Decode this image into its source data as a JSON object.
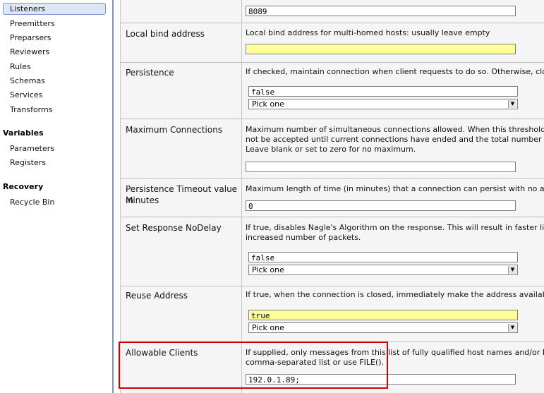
{
  "sidebar": {
    "items": [
      "Listeners",
      "Preemitters",
      "Preparsers",
      "Reviewers",
      "Rules",
      "Schemas",
      "Services",
      "Transforms"
    ],
    "variables_heading": "Variables",
    "variables": [
      "Parameters",
      "Registers"
    ],
    "recovery_heading": "Recovery",
    "recovery": [
      "Recycle Bin"
    ]
  },
  "rows": {
    "port": {
      "value": "8089"
    },
    "local_bind": {
      "label": "Local bind address",
      "desc": "Local bind address for multi-homed hosts: usually leave empty",
      "value": ""
    },
    "persistence": {
      "label": "Persistence",
      "desc": "If checked, maintain connection when client requests to do so. Otherwise, close.",
      "value": "false",
      "select": "Pick one"
    },
    "max_conn": {
      "label": "Maximum Connections",
      "desc1": "Maximum number of simultaneous connections allowed. When this threshold is",
      "desc2": "not be accepted until current connections have ended and the total number of co",
      "desc3": "Leave blank or set to zero for no maximum.",
      "value": ""
    },
    "persist_timeout": {
      "label1": "Persistence Timeout value in",
      "label2": "Minutes",
      "desc": "Maximum length of time (in minutes) that a connection can persist with no activity",
      "value": "0"
    },
    "nodelay": {
      "label": "Set Response NoDelay",
      "desc1": "If true, disables Nagle's Algorithm on the response. This will result in faster line f",
      "desc2": "increased number of packets.",
      "value": "false",
      "select": "Pick one"
    },
    "reuse": {
      "label": "Reuse Address",
      "desc": "If true, when the connection is closed, immediately make the address available, l",
      "value": "true",
      "select": "Pick one"
    },
    "allowable": {
      "label": "Allowable Clients",
      "desc1": "If supplied, only messages from this list of fully qualified host names and/or IP a",
      "desc2": "comma-separated list or use FILE().",
      "value": "192.0.1.89;"
    }
  },
  "colors": {
    "accent_border": "#7d96c8",
    "highlight": "#d30000",
    "required_field": "#ffff99"
  },
  "icons": {
    "select_arrow": "chevron-down-icon"
  }
}
